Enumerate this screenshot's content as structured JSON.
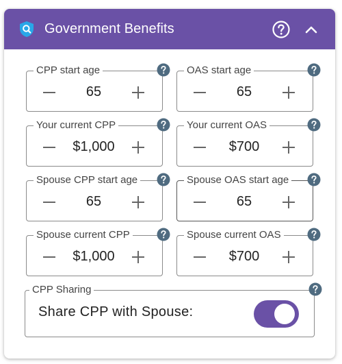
{
  "header": {
    "title": "Government Benefits",
    "icon": "shield-icon",
    "help_icon": "help-circle-icon",
    "collapse_icon": "chevron-up-icon",
    "accent_color": "#6a51a6"
  },
  "fields": [
    {
      "label": "CPP start age",
      "value": "65"
    },
    {
      "label": "OAS start age",
      "value": "65"
    },
    {
      "label": "Your current CPP",
      "value": "$1,000"
    },
    {
      "label": "Your current OAS",
      "value": "$700"
    },
    {
      "label": "Spouse CPP start age",
      "value": "65"
    },
    {
      "label": "Spouse OAS start age",
      "value": "65"
    },
    {
      "label": "Spouse current CPP",
      "value": "$1,000"
    },
    {
      "label": "Spouse current OAS",
      "value": "$700"
    }
  ],
  "sharing": {
    "legend": "CPP Sharing",
    "text": "Share CPP with Spouse:",
    "toggle_on": true
  }
}
